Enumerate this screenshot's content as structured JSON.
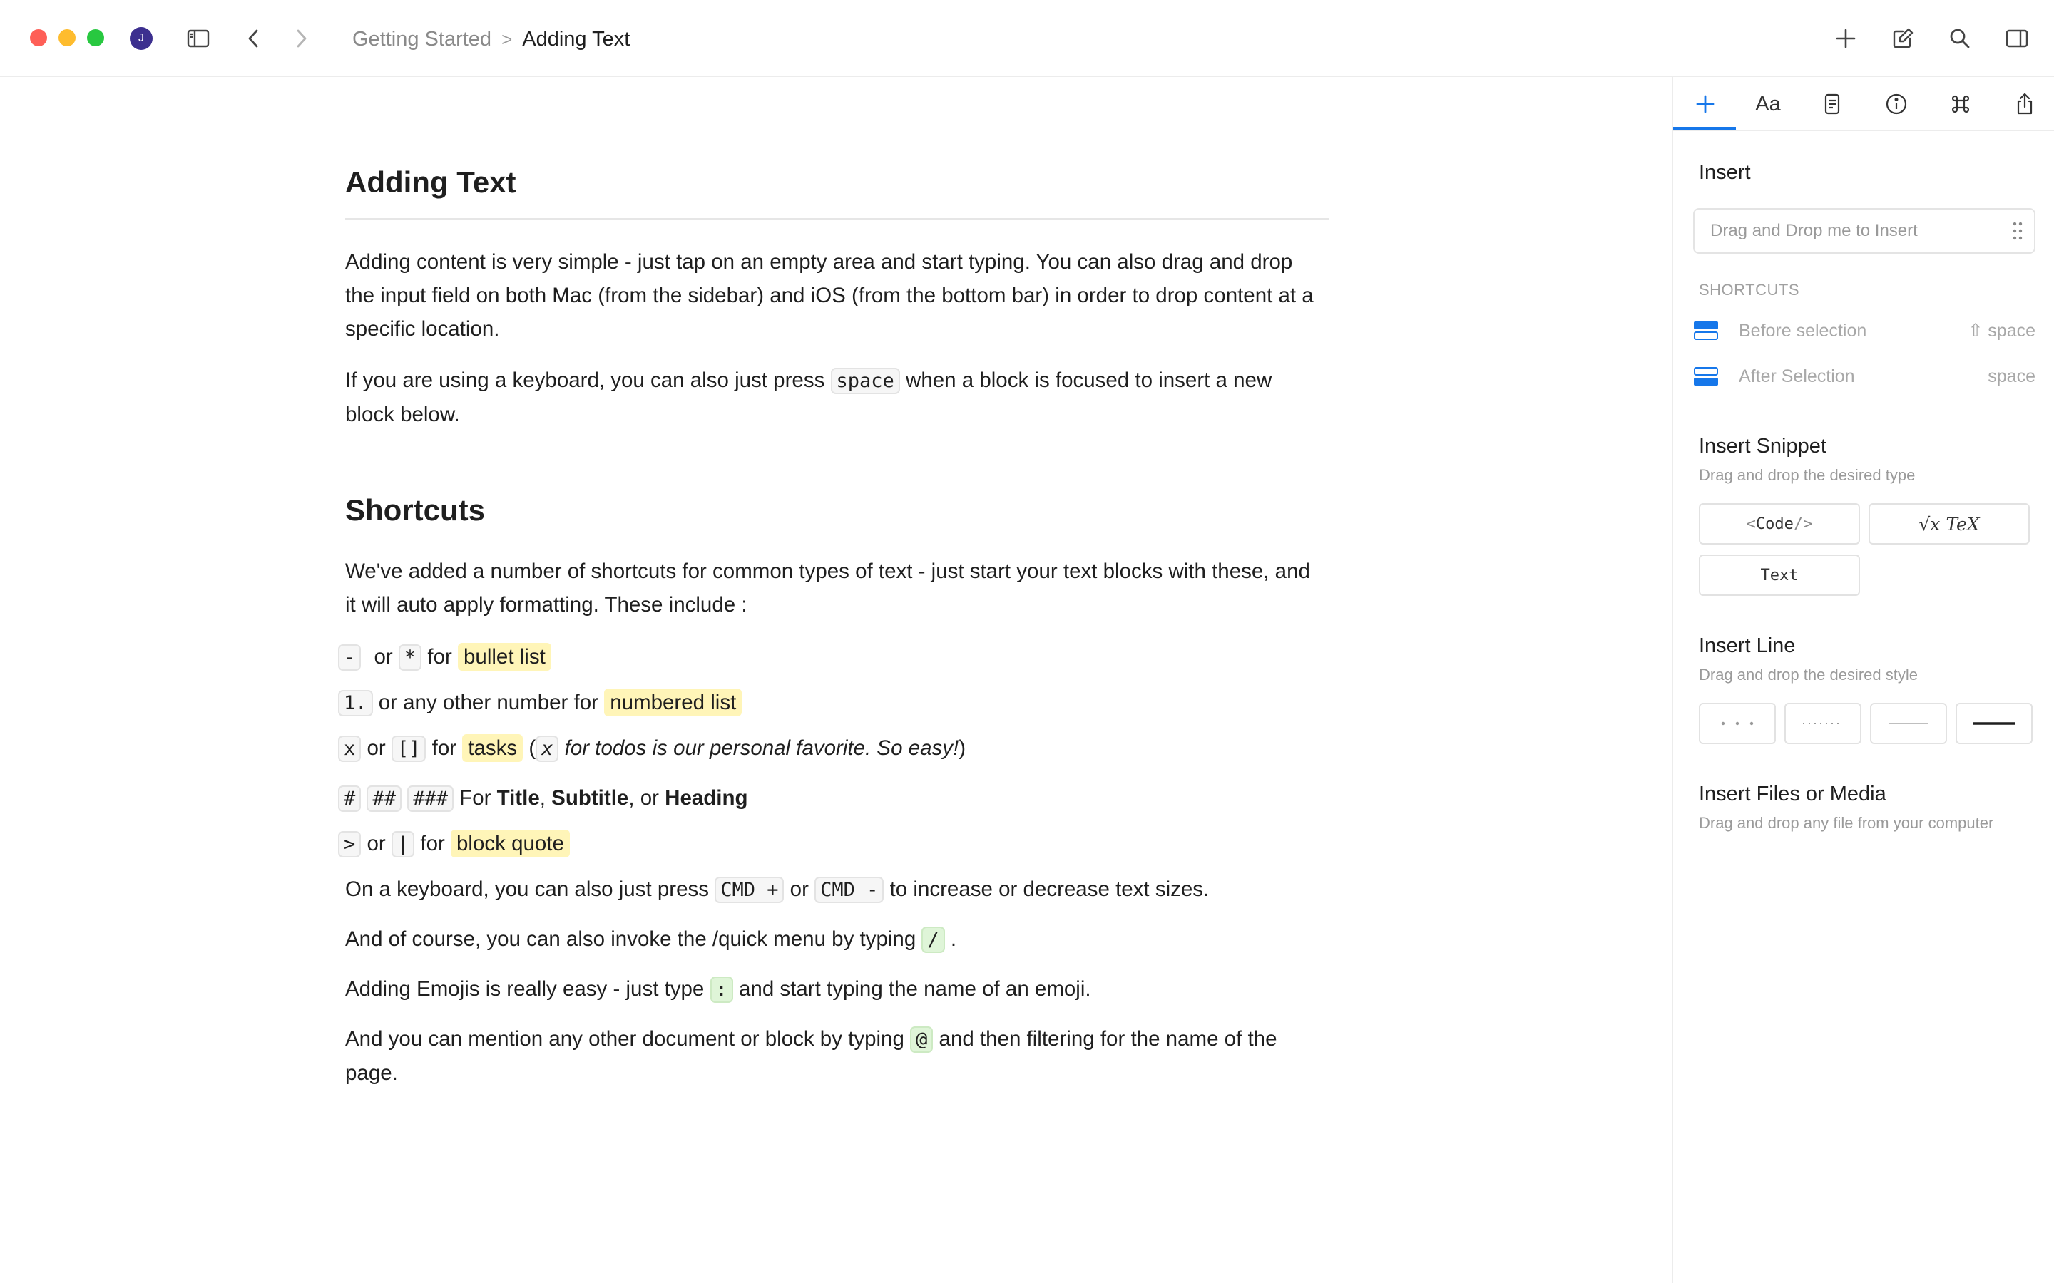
{
  "window": {
    "avatar_letter": "J",
    "breadcrumb": {
      "parent": "Getting Started",
      "separator": ">",
      "current": "Adding Text"
    }
  },
  "toolbar_icons": [
    "sidebar-toggle-icon",
    "back-chevron-icon",
    "forward-chevron-icon",
    "plus-icon",
    "compose-icon",
    "search-icon",
    "right-panel-icon"
  ],
  "document": {
    "title": "Adding Text",
    "intro_p1": "Adding content is very simple - just tap on an empty area and start typing. You can also drag and drop the input field on both Mac (from the sidebar) and iOS (from the bottom bar) in order to drop content at a specific location.",
    "intro_p2_before": "If you are using a keyboard, you can also just press",
    "intro_p2_code": "space",
    "intro_p2_after": "when a block is focused to insert a new block below.",
    "shortcuts_heading": "Shortcuts",
    "shortcuts_intro": "We've added a number of shortcuts for common types of text - just start your text blocks with these, and it will auto apply formatting. These include :",
    "bullet": {
      "code1": "-",
      "or": "or",
      "code2": "*",
      "for": "for",
      "label": "bullet list"
    },
    "numbered": {
      "code": "1.",
      "text": "or any other number for",
      "label": "numbered list"
    },
    "tasks": {
      "code1": "x",
      "or": "or",
      "code2": "[]",
      "for": "for",
      "label": "tasks",
      "open": "(",
      "code3": "x",
      "note": "for todos is our personal favorite. So easy!",
      "close": ")"
    },
    "headings": {
      "code1": "#",
      "code2": "##",
      "code3": "###",
      "for": "For",
      "t1": "Title",
      "sep1": ",",
      "t2": "Subtitle",
      "sep2": ", or",
      "t3": "Heading"
    },
    "quote": {
      "code1": ">",
      "or": "or",
      "code2": "|",
      "for": "for",
      "label": "block quote"
    },
    "sizes": {
      "before": "On a keyboard, you can also just press",
      "code1": "CMD +",
      "or": "or",
      "code2": "CMD -",
      "after": "to increase or decrease text sizes."
    },
    "quickmenu": {
      "before": "And of course, you can also invoke the /quick menu by typing",
      "code": "/",
      "after": "."
    },
    "emoji": {
      "before": "Adding Emojis is really easy - just type",
      "code": ":",
      "after": "and start typing the name of an emoji."
    },
    "mention": {
      "before": "And you can mention any other document or block by typing",
      "code": "@",
      "after": "and then filtering for the name of the page."
    }
  },
  "panel": {
    "tabs": [
      "plus-icon",
      "Aa",
      "document-icon",
      "info-icon",
      "command-icon",
      "share-icon"
    ],
    "insert_title": "Insert",
    "insert_placeholder": "Drag and Drop me to Insert",
    "shortcuts_caption": "SHORTCUTS",
    "shortcuts": [
      {
        "label": "Before selection",
        "key": "⇧ space"
      },
      {
        "label": "After Selection",
        "key": "space"
      }
    ],
    "snippet_title": "Insert Snippet",
    "snippet_sub": "Drag and drop the desired type",
    "snippets": {
      "code_left": "<",
      "code_mid": "Code",
      "code_right": "/>",
      "tex": "√x TeX",
      "text": "Text"
    },
    "line_title": "Insert Line",
    "line_sub": "Drag and drop the desired style",
    "files_title": "Insert Files or Media",
    "files_sub": "Drag and drop any file from your computer"
  },
  "colors": {
    "accent": "#1677ea",
    "highlight_yellow": "#fff5b8",
    "highlight_green": "#dff5d8"
  }
}
